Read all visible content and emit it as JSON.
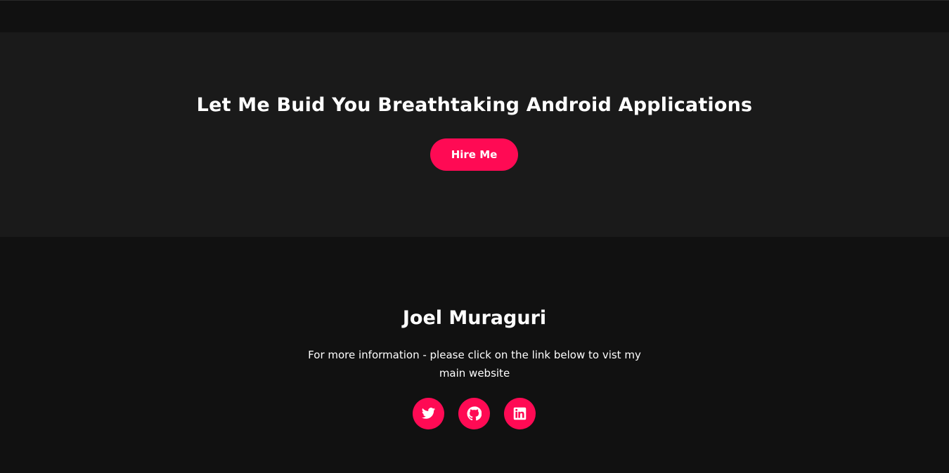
{
  "cta": {
    "title": "Let Me Buid You Breathtaking Android Applications",
    "button_label": "Hire Me"
  },
  "footer": {
    "name": "Joel Muraguri",
    "description": "For more information - please click on the link below to vist my main website",
    "social_links": [
      {
        "icon": "twitter-icon"
      },
      {
        "icon": "github-icon"
      },
      {
        "icon": "linkedin-icon"
      }
    ]
  },
  "colors": {
    "accent": "#ff0a54",
    "section_bg": "#1a1a1a",
    "page_bg": "#111111",
    "text": "#ffffff"
  }
}
